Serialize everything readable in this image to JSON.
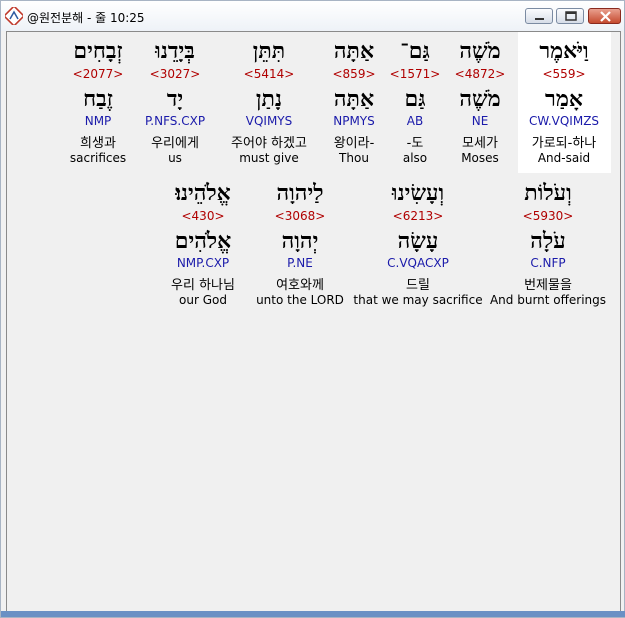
{
  "window": {
    "title": "@원전분해 - 줄 10:25"
  },
  "lines": [
    {
      "words": [
        {
          "heb1": "וַיֹּאמֶר",
          "num": "<559>",
          "heb2": "אָמַר",
          "morph": "CW.VQIMZS",
          "kor": "가로되-하나",
          "eng": "And-said",
          "selected": true
        },
        {
          "heb1": "מֹשֶׁה",
          "num": "<4872>",
          "heb2": "מֹשֶׁה",
          "morph": "NE",
          "kor": "모세가",
          "eng": "Moses"
        },
        {
          "heb1": "גַּם־",
          "num": "<1571>",
          "heb2": "גַּם",
          "morph": "AB",
          "kor": "-도",
          "eng": "also"
        },
        {
          "heb1": "אַתָּה",
          "num": "<859>",
          "heb2": "אַתָּה",
          "morph": "NPMYS",
          "kor": "왕이라-",
          "eng": "Thou"
        },
        {
          "heb1": "תִּתֵּן",
          "num": "<5414>",
          "heb2": "נָתַן",
          "morph": "VQIMYS",
          "kor": "주어야 하겠고",
          "eng": "must give"
        },
        {
          "heb1": "בְּיָדֵנוּ",
          "num": "<3027>",
          "heb2": "יָד",
          "morph": "P.NFS.CXP",
          "kor": "우리에게",
          "eng": "us"
        },
        {
          "heb1": "זְבָחִים",
          "num": "<2077>",
          "heb2": "זֶבַח",
          "morph": "NMP",
          "kor": "희생과",
          "eng": "sacrifices"
        }
      ]
    },
    {
      "words": [
        {
          "heb1": "וְעֹלוֹת",
          "num": "<5930>",
          "heb2": "עֹלָה",
          "morph": "C.NFP",
          "kor": "번제물을",
          "eng": "And burnt offerings"
        },
        {
          "heb1": "וְעָשִׂינוּ",
          "num": "<6213>",
          "heb2": "עָשָׂה",
          "morph": "C.VQACXP",
          "kor": "드릴",
          "eng": "that we may sacrifice"
        },
        {
          "heb1": "לַיהוָה",
          "num": "<3068>",
          "heb2": "יְהוָה",
          "morph": "P.NE",
          "kor": "여호와께",
          "eng": "unto the LORD"
        },
        {
          "heb1": "אֱלֹהֵינוּ׃",
          "num": "<430>",
          "heb2": "אֱלֹהִים",
          "morph": "NMP.CXP",
          "kor": "우리 하나님",
          "eng": "our God"
        }
      ]
    }
  ]
}
